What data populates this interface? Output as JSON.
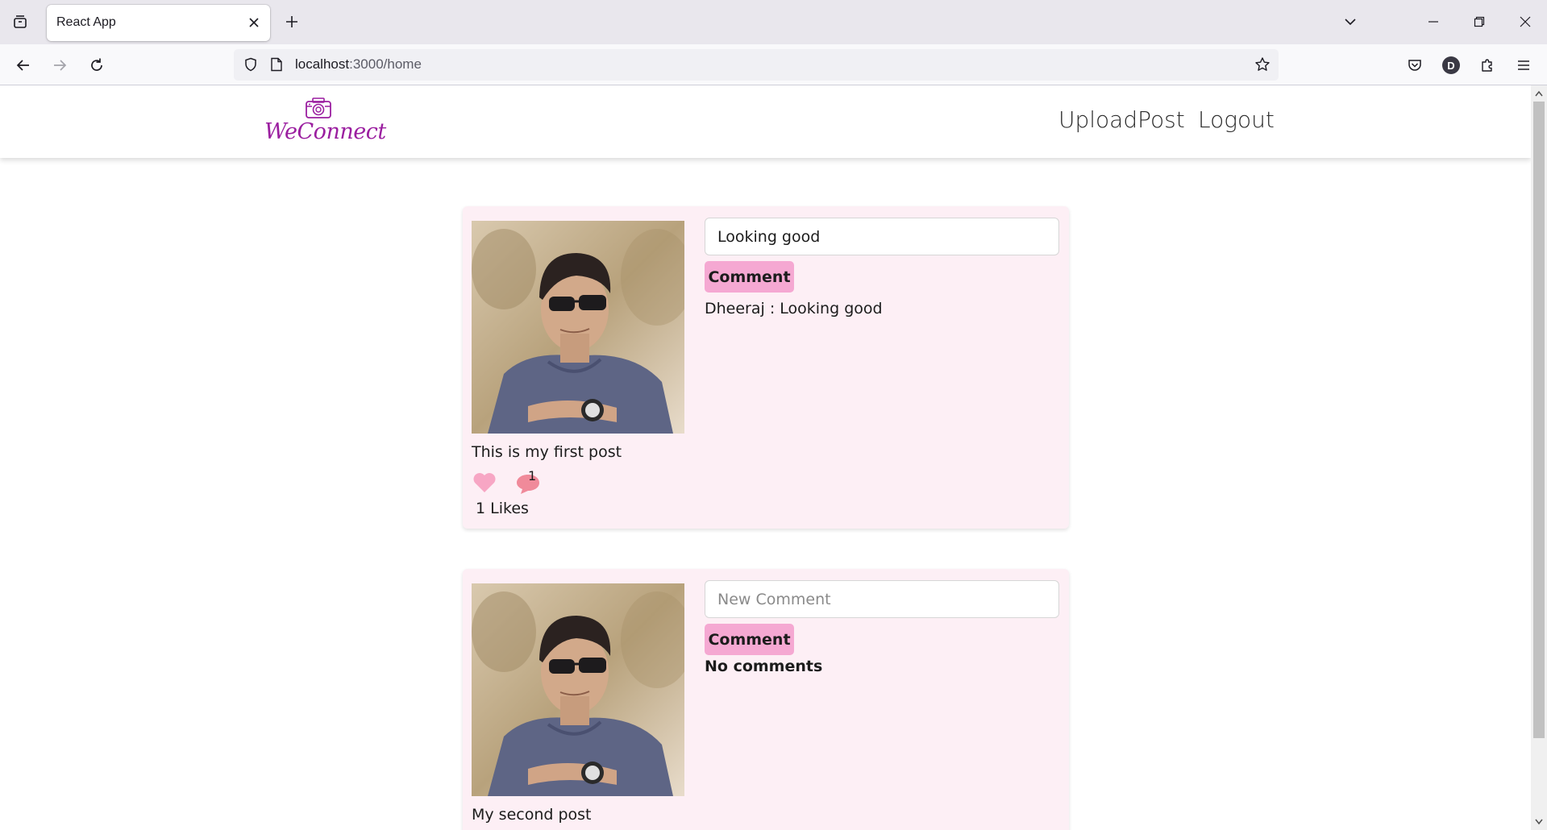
{
  "browser": {
    "tab_title": "React App",
    "url_host": "localhost",
    "url_path": ":3000/home",
    "account_initial": "D"
  },
  "site": {
    "logo_text": "WeConnect",
    "nav": {
      "upload_label": "UploadPost",
      "logout_label": "Logout"
    }
  },
  "posts": [
    {
      "caption": "This is my first post",
      "likes_text": "1 Likes",
      "comment_count": "1",
      "comment_input_value": "Looking good",
      "comment_input_placeholder": "New Comment",
      "comment_button_label": "Comment",
      "comments": [
        {
          "text": "Dheeraj : Looking good"
        }
      ]
    },
    {
      "caption": "My second post",
      "comment_input_value": "",
      "comment_input_placeholder": "New Comment",
      "comment_button_label": "Comment",
      "no_comments_text": "No comments"
    }
  ],
  "icons": {
    "like": "heart-icon",
    "comment": "speech-bubble-icon",
    "logo": "camera-icon"
  },
  "colors": {
    "logo": "#9b1fa0",
    "card_background": "#fdeff5",
    "comment_button": "#f5a8d2",
    "like_icon": "#f7a6c4",
    "comment_icon": "#f08a9a"
  }
}
